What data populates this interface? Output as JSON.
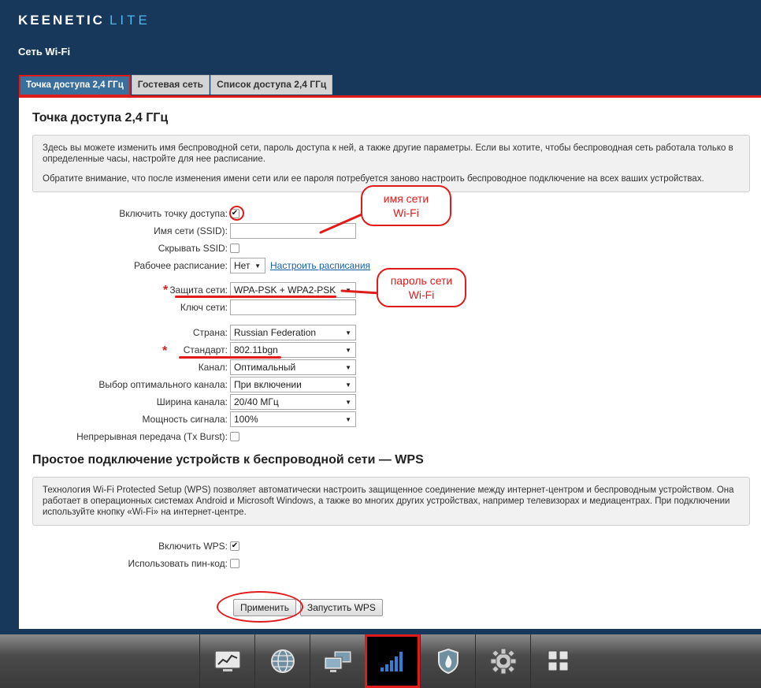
{
  "brand": {
    "name": "KEENETIC",
    "model": "LITE"
  },
  "page_title": "Сеть Wi-Fi",
  "tabs": [
    {
      "label": "Точка доступа 2,4 ГГц",
      "active": true
    },
    {
      "label": "Гостевая сеть"
    },
    {
      "label": "Список доступа 2,4 ГГц"
    }
  ],
  "ap": {
    "heading": "Точка доступа 2,4 ГГц",
    "info1": "Здесь вы можете изменить имя беспроводной сети, пароль доступа к ней, а также другие параметры. Если вы хотите, чтобы беспроводная сеть работала только в определенные часы, настройте для нее расписание.",
    "info2": "Обратите внимание, что после изменения имени сети или ее пароля потребуется заново настроить беспроводное подключение на всех ваших устройствах."
  },
  "form": {
    "enable_ap": {
      "label": "Включить точку доступа:",
      "checked": true
    },
    "ssid": {
      "label": "Имя сети (SSID):",
      "value": ""
    },
    "hide_ssid": {
      "label": "Скрывать SSID:",
      "checked": false
    },
    "schedule": {
      "label": "Рабочее расписание:",
      "value": "Нет",
      "link": "Настроить расписания"
    },
    "security": {
      "label": "Защита сети:",
      "value": "WPA-PSK + WPA2-PSK"
    },
    "key": {
      "label": "Ключ сети:",
      "value": ""
    },
    "country": {
      "label": "Страна:",
      "value": "Russian Federation"
    },
    "standard": {
      "label": "Стандарт:",
      "value": "802.11bgn"
    },
    "channel": {
      "label": "Канал:",
      "value": "Оптимальный"
    },
    "optimal_channel": {
      "label": "Выбор оптимального канала:",
      "value": "При включении"
    },
    "bandwidth": {
      "label": "Ширина канала:",
      "value": "20/40 МГц"
    },
    "power": {
      "label": "Мощность сигнала:",
      "value": "100%"
    },
    "tx_burst": {
      "label": "Непрерывная передача (Tx Burst):",
      "checked": false
    }
  },
  "wps": {
    "heading": "Простое подключение устройств к беспроводной сети — WPS",
    "info": "Технология Wi-Fi Protected Setup (WPS) позволяет автоматически настроить защищенное соединение между интернет-центром и беспроводным устройством. Она работает в операционных системах Android и Microsoft Windows, а также во многих других устройствах, например телевизорах и медиацентрах. При подключении используйте кнопку «Wi-Fi» на интернет-центре.",
    "enable": {
      "label": "Включить WPS:",
      "checked": true
    },
    "pin": {
      "label": "Использовать пин-код:",
      "checked": false
    }
  },
  "buttons": {
    "apply": "Применить",
    "start_wps": "Запустить WPS"
  },
  "annotations": {
    "ssid_callout": {
      "line1": "имя сети",
      "line2": "Wi-Fi"
    },
    "key_callout": {
      "line1": "пароль сети",
      "line2": "Wi-Fi"
    },
    "required_mark": "*"
  },
  "dock": [
    {
      "icon": "monitor-chart-icon"
    },
    {
      "icon": "globe-icon"
    },
    {
      "icon": "computers-icon"
    },
    {
      "icon": "wifi-signal-icon",
      "active": true
    },
    {
      "icon": "shield-icon"
    },
    {
      "icon": "gear-icon"
    },
    {
      "icon": "apps-grid-icon"
    }
  ],
  "colors": {
    "background": "#17385a",
    "accent": "#e01b1b",
    "tab_active": "#3a6f9c",
    "logo_lite": "#4bb8ee"
  }
}
